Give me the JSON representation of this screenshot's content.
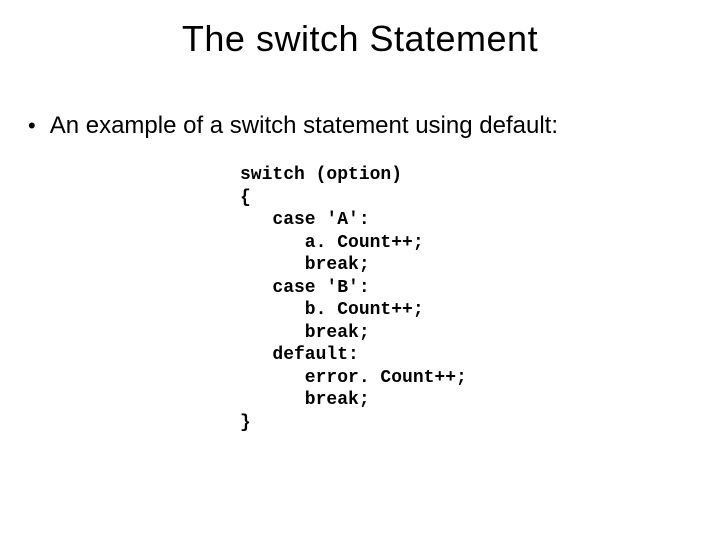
{
  "title": "The switch Statement",
  "bullet": "An example of a switch statement using default:",
  "code": "switch (option)\n{\n   case 'A':\n      a. Count++;\n      break;\n   case 'B':\n      b. Count++;\n      break;\n   default:\n      error. Count++;\n      break;\n}"
}
